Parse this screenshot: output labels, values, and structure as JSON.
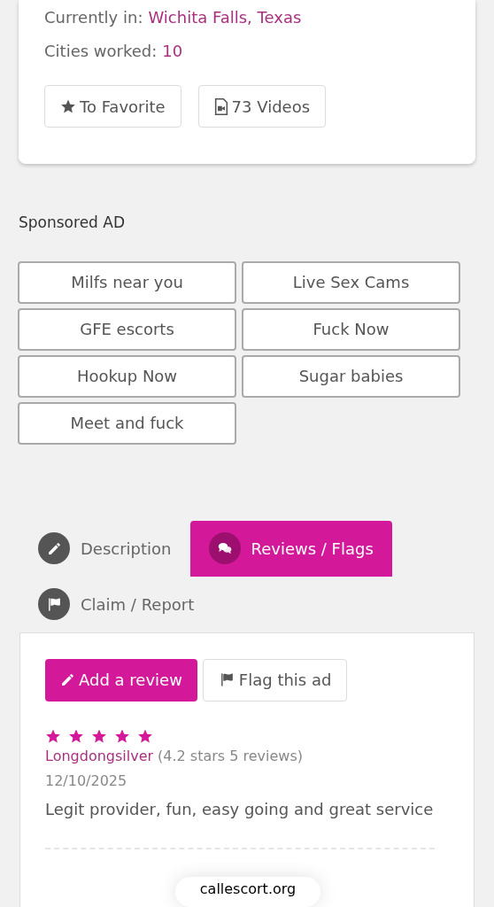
{
  "profile": {
    "location_label": "Currently in:",
    "location": "Wichita Falls, Texas",
    "cities_label": "Cities worked:",
    "cities": "10",
    "buttons": [
      {
        "kind": "favorite",
        "label": "To Favorite"
      },
      {
        "kind": "videos",
        "label": "73 Videos"
      }
    ]
  },
  "sponsored": {
    "title": "Sponsored AD",
    "links": [
      "Milfs near you",
      "Live Sex Cams",
      "GFE escorts",
      "Fuck Now",
      "Hookup Now",
      "Sugar babies",
      "Meet and fuck"
    ]
  },
  "tabs": [
    {
      "kind": "description",
      "label": "Description",
      "selected": false
    },
    {
      "kind": "reviews",
      "label": "Reviews / Flags",
      "selected": true
    },
    {
      "kind": "report",
      "label": "Claim / Report",
      "selected": false
    }
  ],
  "review_actions": [
    {
      "kind": "add",
      "label": "Add a review"
    },
    {
      "kind": "flag",
      "label": "Flag this ad"
    }
  ],
  "reviews": [
    {
      "stars": 5,
      "author": "Longdongsilver",
      "author_stats": "(4.2 stars 5 reviews)",
      "date": "12/10/2025",
      "text": "Legit provider, fun, easy going and great service"
    }
  ],
  "browser_url": "callescort.org"
}
